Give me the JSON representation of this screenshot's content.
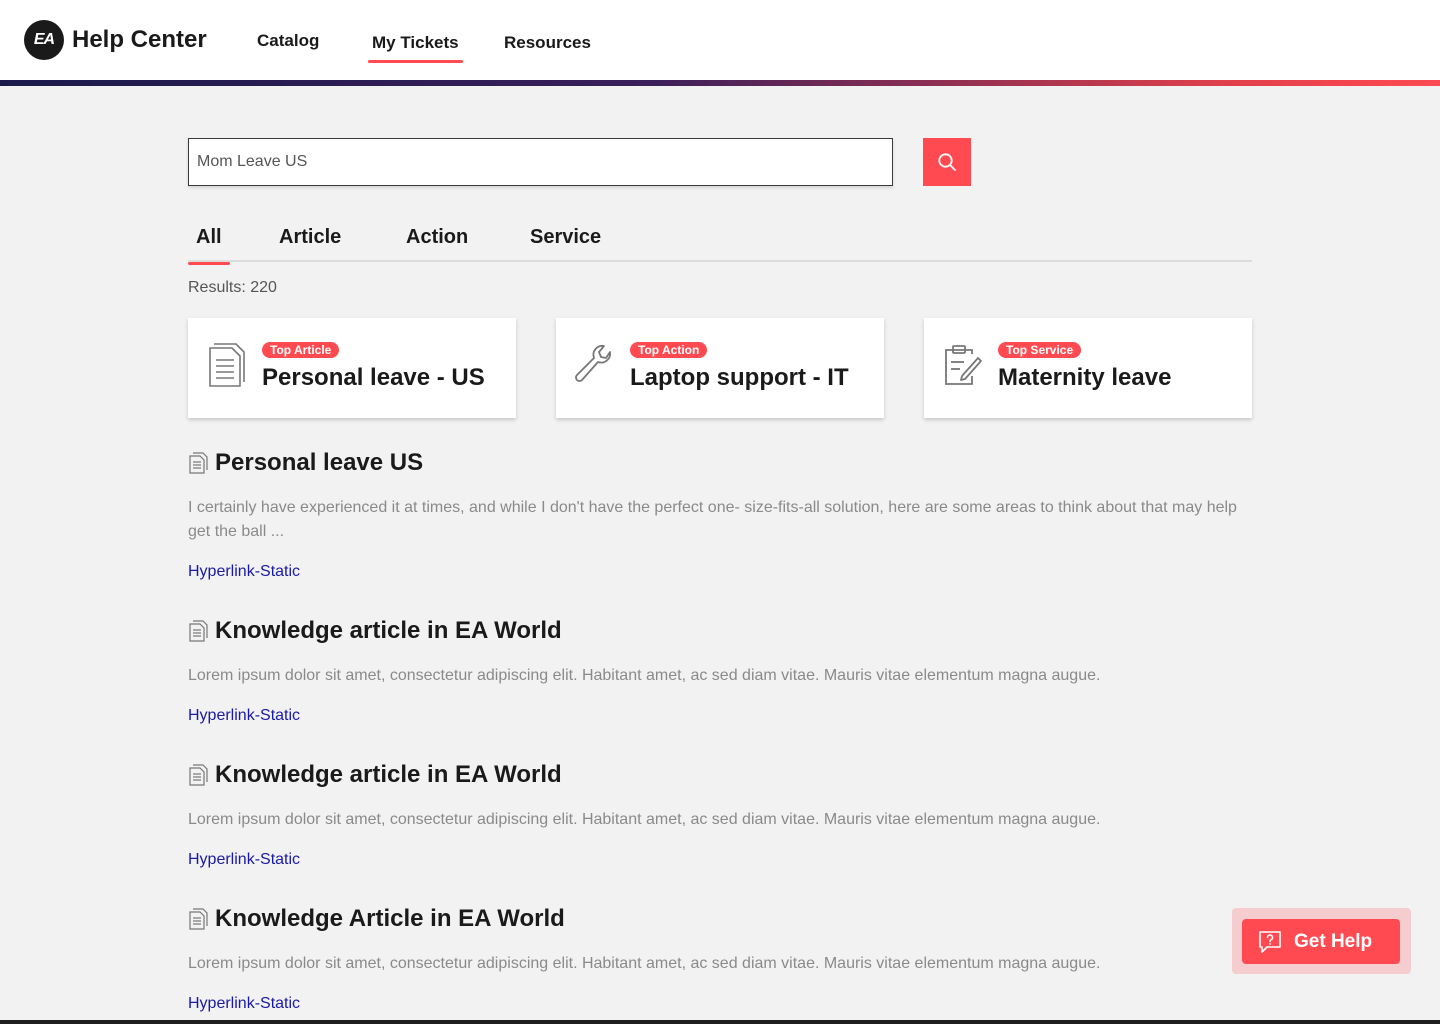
{
  "header": {
    "logo_text": "EA",
    "title": "Help Center",
    "nav": [
      {
        "label": "Catalog"
      },
      {
        "label": "My Tickets",
        "active": true
      },
      {
        "label": "Resources"
      }
    ]
  },
  "search": {
    "value": "Mom Leave US",
    "button_icon": "search-icon"
  },
  "tabs": [
    {
      "label": "All",
      "active": true
    },
    {
      "label": "Article"
    },
    {
      "label": "Action"
    },
    {
      "label": "Service"
    }
  ],
  "results_text": "Results: 220",
  "top_cards": [
    {
      "badge": "Top Article",
      "title": "Personal leave - US",
      "icon": "document-icon"
    },
    {
      "badge": "Top Action",
      "title": "Laptop support - IT",
      "icon": "wrench-icon"
    },
    {
      "badge": "Top Service",
      "title": "Maternity leave",
      "icon": "clipboard-edit-icon"
    }
  ],
  "results": [
    {
      "title": "Personal leave US",
      "description": "I certainly have experienced it at times, and while I don't have the perfect one- size-fits-all solution, here are some areas to think about that may help get the ball  ...",
      "link": "Hyperlink-Static"
    },
    {
      "title": "Knowledge article in EA World",
      "description": "Lorem ipsum dolor sit amet, consectetur adipiscing elit. Habitant amet, ac sed diam vitae. Mauris vitae elementum magna augue.",
      "link": "Hyperlink-Static"
    },
    {
      "title": "Knowledge article in EA World",
      "description": "Lorem ipsum dolor sit amet, consectetur adipiscing elit. Habitant amet, ac sed diam vitae. Mauris vitae elementum magna augue.",
      "link": "Hyperlink-Static"
    },
    {
      "title": "Knowledge Article in EA World",
      "description": "Lorem ipsum dolor sit amet, consectetur adipiscing elit. Habitant amet, ac sed diam vitae. Mauris vitae elementum magna augue.",
      "link": "Hyperlink-Static"
    }
  ],
  "help_button": {
    "label": "Get Help",
    "icon": "chat-question-icon"
  },
  "colors": {
    "accent": "#ff4a52",
    "link": "#1a1aa6",
    "background": "#f2f2f2"
  }
}
